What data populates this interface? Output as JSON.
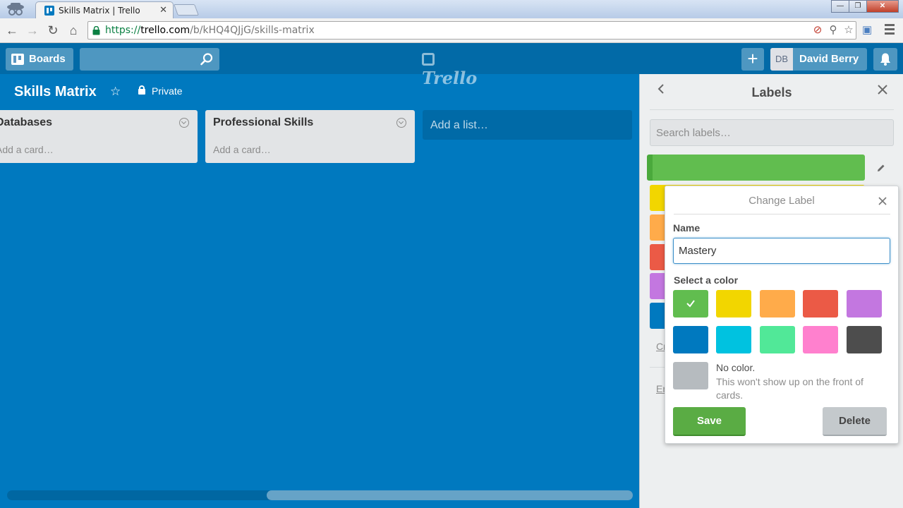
{
  "browser": {
    "tab_title": "Skills Matrix | Trello",
    "tab_close": "✕",
    "url_scheme": "https://",
    "url_host": "trello.com",
    "url_path": "/b/kHQ4QJjG/skills-matrix",
    "nav": {
      "back": "←",
      "forward": "→",
      "reload": "↻",
      "home": "⌂"
    },
    "window_controls": {
      "minimize": "—",
      "restore": "❐",
      "close": "✕"
    }
  },
  "header": {
    "boards_label": "Boards",
    "logo_text": "Trello",
    "add_label": "+",
    "user_initials": "DB",
    "user_name": "David Berry"
  },
  "board": {
    "title": "Skills Matrix",
    "star": "☆",
    "visibility": "Private",
    "lists": [
      {
        "name": "Databases",
        "add_card": "Add a card…"
      },
      {
        "name": "Professional Skills",
        "add_card": "Add a card…"
      }
    ],
    "add_list": "Add a list…"
  },
  "sidebar": {
    "title": "Labels",
    "search_placeholder": "Search labels…",
    "labels": [
      {
        "color": "#61bd4f"
      },
      {
        "color": "#f2d600"
      },
      {
        "color": "#ffab4a"
      },
      {
        "color": "#eb5a46"
      },
      {
        "color": "#c377e0"
      },
      {
        "color": "#0079bf"
      }
    ],
    "link_create": "Cr",
    "link_enable": "En"
  },
  "popover": {
    "title": "Change Label",
    "name_label": "Name",
    "name_value": "Mastery",
    "color_label": "Select a color",
    "colors": [
      {
        "name": "green",
        "hex": "#61bd4f",
        "selected": true
      },
      {
        "name": "yellow",
        "hex": "#f2d600"
      },
      {
        "name": "orange",
        "hex": "#ffab4a"
      },
      {
        "name": "red",
        "hex": "#eb5a46"
      },
      {
        "name": "purple",
        "hex": "#c377e0"
      },
      {
        "name": "blue",
        "hex": "#0079bf"
      },
      {
        "name": "sky",
        "hex": "#00c2e0"
      },
      {
        "name": "lime",
        "hex": "#51e898"
      },
      {
        "name": "pink",
        "hex": "#ff80ce"
      },
      {
        "name": "black",
        "hex": "#4d4d4d"
      }
    ],
    "no_color_hex": "#b6bbbf",
    "no_color_title": "No color.",
    "no_color_desc": "This won't show up on the front of cards.",
    "save_label": "Save",
    "delete_label": "Delete"
  }
}
